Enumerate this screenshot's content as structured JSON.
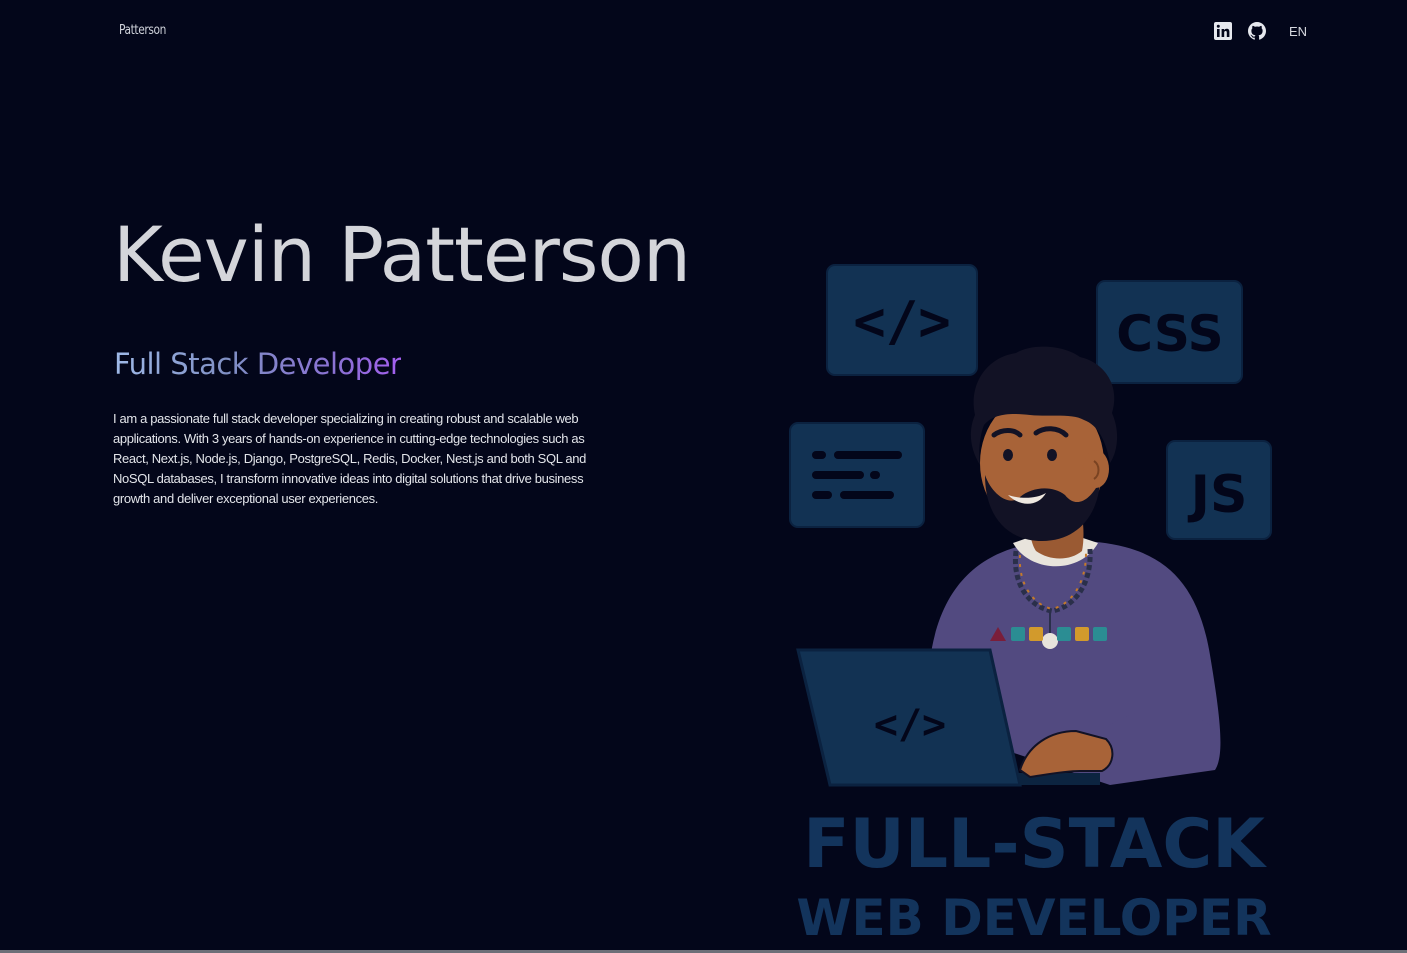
{
  "brand": {
    "name": "Patterson"
  },
  "nav": {
    "icons": [
      "linkedin-icon",
      "github-icon"
    ],
    "language": "EN"
  },
  "hero": {
    "name": "Kevin Patterson",
    "role": "Full Stack Developer",
    "bio": "I am a passionate full stack developer specializing in creating robust and scalable web applications. With 3 years of hands-on experience in cutting-edge technologies such as React, Next.js, Node.js, Django, PostgreSQL, Redis, Docker, Nest.js and both SQL and NoSQL databases, I transform innovative ideas into digital solutions that drive business growth and deliver exceptional user experiences."
  },
  "illustration": {
    "code_tag": "</>",
    "css_badge": "CSS",
    "js_badge": "JS",
    "laptop_tag": "</>",
    "headline_line1": "FULL-STACK",
    "headline_line2": "WEB DEVELOPER"
  },
  "colors": {
    "background": "#03061a",
    "text": "#d4d5da",
    "gradient_start": "#9fb9e8",
    "gradient_end": "#a45ff0",
    "illustration_panel": "#123253",
    "illustration_text": "#13345c",
    "sweater": "#524a80"
  }
}
